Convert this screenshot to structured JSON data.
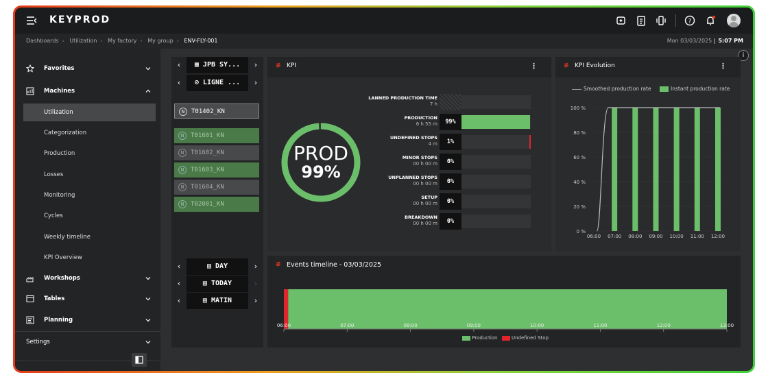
{
  "app": {
    "logo": "KEYPROD"
  },
  "breadcrumb": [
    "Dashboards",
    "Utilization",
    "My factory",
    "My group"
  ],
  "breadcrumb_current": "ENV-FLY-001",
  "date": "Mon 03/03/2025",
  "time": "5:07 PM",
  "info": "i",
  "sidebar": {
    "favorites": "Favorites",
    "machines": "Machines",
    "subitems": [
      "Utilization",
      "Categorization",
      "Production",
      "Losses",
      "Monitoring",
      "Cycles",
      "Weekly timeline",
      "KPI Overview"
    ],
    "workshops": "Workshops",
    "tables": "Tables",
    "planning": "Planning",
    "settings": "Settings"
  },
  "selectors": {
    "site": "JPB SY...",
    "line": "LIGNE ...",
    "machines": [
      "T01402_KN",
      "T01601_KN",
      "T01602_KN",
      "T01603_KN",
      "T01604_KN",
      "T02001_KN"
    ],
    "period": "DAY",
    "day": "TODAY",
    "shift": "MATIN"
  },
  "kpi": {
    "title": "KPI",
    "gauge_label": "PROD",
    "gauge_value": "99%",
    "gauge_fraction": 0.99,
    "rows": [
      {
        "name": "LANNED PRODUCTION TIME",
        "dur": "7 h",
        "pct": "",
        "fill": 0
      },
      {
        "name": "PRODUCTION",
        "dur": "6 h 55 m",
        "pct": "99%",
        "fill": 0.99
      },
      {
        "name": "UNDEFINED STOPS",
        "dur": "4 m",
        "pct": "1%",
        "fill": 0.01
      },
      {
        "name": "MINOR STOPS",
        "dur": "00 h 00 m",
        "pct": "0%",
        "fill": 0
      },
      {
        "name": "UNPLANNED STOPS",
        "dur": "00 h 00 m",
        "pct": "0%",
        "fill": 0
      },
      {
        "name": "SETUP",
        "dur": "00 h 00 m",
        "pct": "0%",
        "fill": 0
      },
      {
        "name": "BREAKDOWN",
        "dur": "00 h 00 m",
        "pct": "0%",
        "fill": 0
      }
    ]
  },
  "kpi_evolution": {
    "title": "KPI Evolution",
    "legend_smoothed": "Smoothed production rate",
    "legend_instant": "Instant production rate",
    "yticks": [
      "100 %",
      "80 %",
      "60 %",
      "40 %",
      "20 %",
      "0 %"
    ],
    "xticks": [
      "06:00",
      "07:00",
      "08:00",
      "09:00",
      "10:00",
      "11:00",
      "12:00"
    ]
  },
  "events": {
    "title": "Events timeline",
    "date": "- 03/03/2025",
    "xticks": [
      "06:00",
      "07:00",
      "08:00",
      "09:00",
      "10:00",
      "11:00",
      "12:00",
      "13:00"
    ],
    "legend_production": "Production",
    "legend_undefined": "Undefined Stop"
  },
  "colors": {
    "production": "#6cbf6a",
    "undefined": "#e0262c",
    "accent": "#e53a1c"
  },
  "chart_data": [
    {
      "type": "bar",
      "title": "KPI Evolution",
      "categories": [
        "06:30",
        "07:00",
        "07:30",
        "08:00",
        "08:30",
        "09:00",
        "09:30",
        "10:00",
        "10:30",
        "11:00",
        "11:30",
        "12:00"
      ],
      "series": [
        {
          "name": "Instant production rate",
          "values": [
            100,
            100,
            100,
            100,
            100,
            100,
            100,
            100,
            100,
            100,
            100,
            100
          ]
        },
        {
          "name": "Smoothed production rate",
          "values": [
            0,
            100,
            100,
            100,
            100,
            100,
            100,
            100,
            100,
            100,
            100,
            100
          ]
        }
      ],
      "ylim": [
        0,
        100
      ]
    },
    {
      "type": "bar",
      "title": "Events timeline",
      "x": [
        "06:00",
        "13:00"
      ],
      "series": [
        {
          "name": "Undefined Stop",
          "start": "06:00",
          "end": "06:04"
        },
        {
          "name": "Production",
          "start": "06:04",
          "end": "13:00"
        }
      ]
    }
  ]
}
